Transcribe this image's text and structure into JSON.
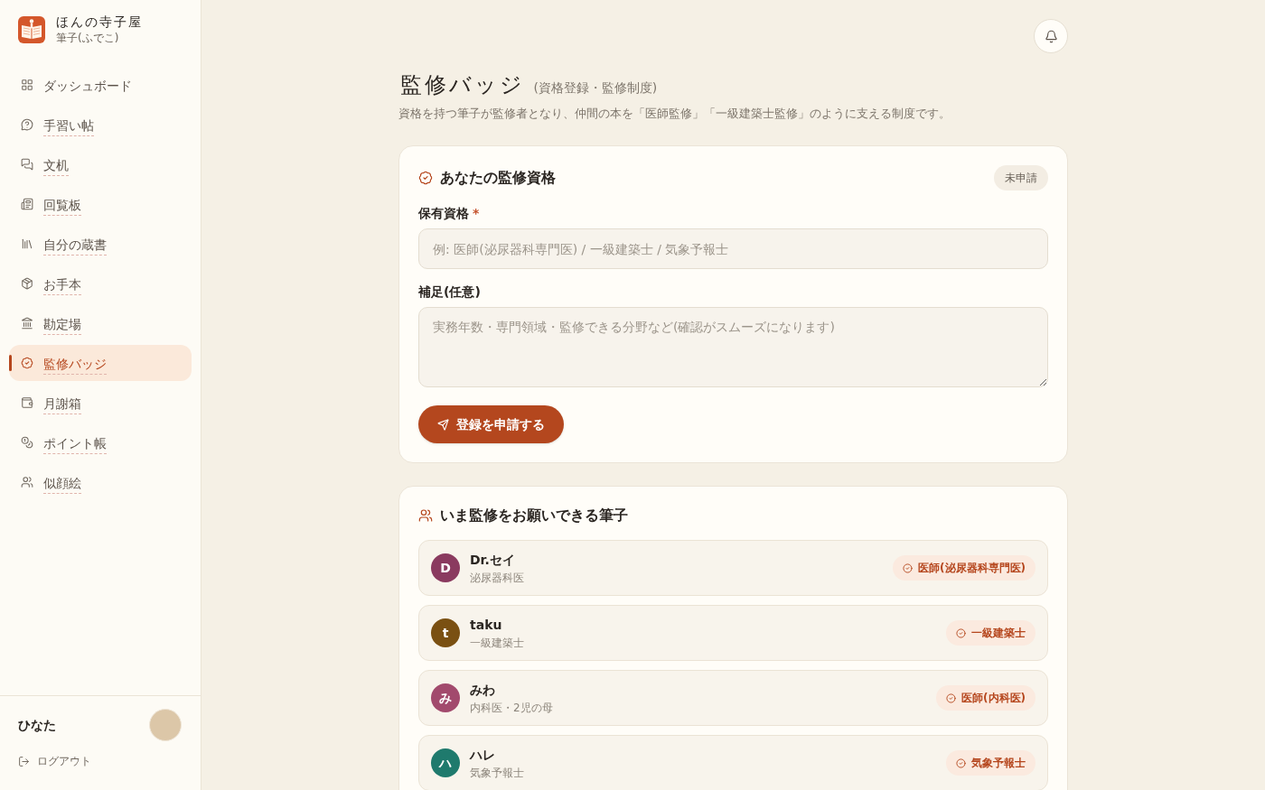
{
  "app": {
    "name": "ほんの寺子屋",
    "subtitle": "筆子(ふでこ)"
  },
  "sidebar": {
    "items": [
      {
        "label": "ダッシュボード",
        "selected": false,
        "dashed_underline": false
      },
      {
        "label": "手習い帖",
        "selected": false,
        "dashed_underline": true
      },
      {
        "label": "文机",
        "selected": false,
        "dashed_underline": true
      },
      {
        "label": "回覧板",
        "selected": false,
        "dashed_underline": true
      },
      {
        "label": "自分の蔵書",
        "selected": false,
        "dashed_underline": true
      },
      {
        "label": "お手本",
        "selected": false,
        "dashed_underline": true
      },
      {
        "label": "勘定場",
        "selected": false,
        "dashed_underline": true
      },
      {
        "label": "監修バッジ",
        "selected": true,
        "dashed_underline": true
      },
      {
        "label": "月謝箱",
        "selected": false,
        "dashed_underline": true
      },
      {
        "label": "ポイント帳",
        "selected": false,
        "dashed_underline": true
      },
      {
        "label": "似顔絵",
        "selected": false,
        "dashed_underline": true
      }
    ]
  },
  "user": {
    "name": "ひなた",
    "logout": "ログアウト"
  },
  "page": {
    "title": "監修バッジ",
    "subtitle": "(資格登録・監修制度)",
    "description": "資格を持つ筆子が監修者となり、仲間の本を「医師監修」「一級建築士監修」のように支える制度です。"
  },
  "qualification_card": {
    "title": "あなたの監修資格",
    "status": "未申請",
    "fields": [
      {
        "kind": "input",
        "label": "保有資格",
        "required_mark": "*",
        "placeholder": "例: 医師(泌尿器科専門医) / 一級建築士 / 気象予報士"
      },
      {
        "kind": "textarea",
        "label": "補足(任意)",
        "placeholder": "実務年数・専門領域・監修できる分野など(確認がスムーズになります)"
      }
    ],
    "submit": "登録を申請する"
  },
  "supervisors_card": {
    "title": "いま監修をお願いできる筆子",
    "people": [
      {
        "initial": "D",
        "name": "Dr.セイ",
        "role": "泌尿器科医",
        "badge": "医師(泌尿器科専門医)",
        "color": "#8a3a5f"
      },
      {
        "initial": "t",
        "name": "taku",
        "role": "一級建築士",
        "badge": "一級建築士",
        "color": "#7a5012"
      },
      {
        "initial": "み",
        "name": "みわ",
        "role": "内科医・2児の母",
        "badge": "医師(内科医)",
        "color": "#a24a6d"
      },
      {
        "initial": "ハ",
        "name": "ハレ",
        "role": "気象予報士",
        "badge": "気象予報士",
        "color": "#1f7a6d"
      }
    ]
  }
}
